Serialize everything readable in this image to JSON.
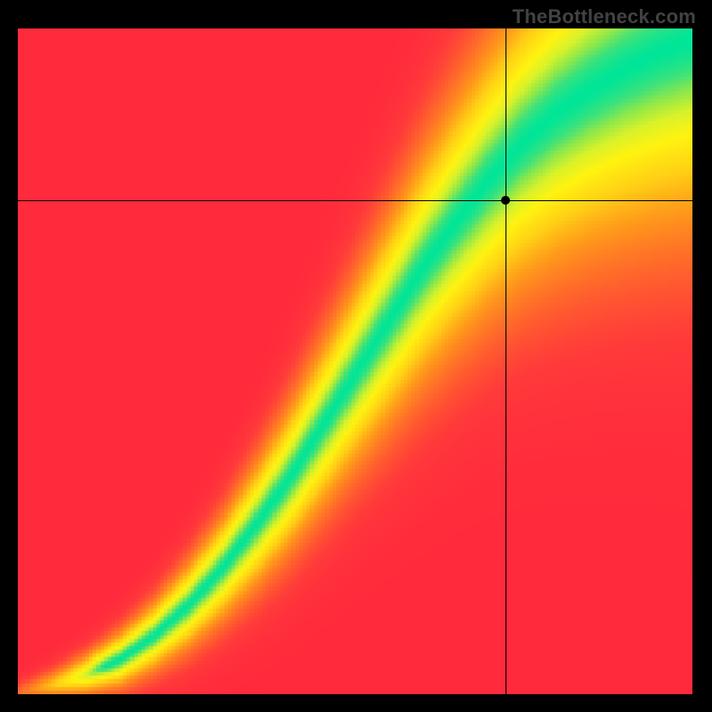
{
  "watermark": "TheBottleneck.com",
  "chart_data": {
    "type": "heatmap",
    "title": "",
    "xlabel": "",
    "ylabel": "",
    "xlim": [
      0,
      1
    ],
    "ylim": [
      0,
      1
    ],
    "crosshair": {
      "x": 0.723,
      "y": 0.742
    },
    "color_scale": [
      {
        "value": 0.0,
        "color": "#ff2a3c"
      },
      {
        "value": 0.1,
        "color": "#ff3a3a"
      },
      {
        "value": 0.25,
        "color": "#ff6a2a"
      },
      {
        "value": 0.4,
        "color": "#ff9a1a"
      },
      {
        "value": 0.55,
        "color": "#ffd015"
      },
      {
        "value": 0.7,
        "color": "#fff310"
      },
      {
        "value": 0.8,
        "color": "#d8f22a"
      },
      {
        "value": 0.88,
        "color": "#8fe84a"
      },
      {
        "value": 0.94,
        "color": "#3fe27a"
      },
      {
        "value": 1.0,
        "color": "#00e598"
      }
    ],
    "ridge_curve": {
      "description": "Fit y = f(x) along which fitness peaks (green)",
      "points": [
        [
          0.0,
          0.0
        ],
        [
          0.05,
          0.01
        ],
        [
          0.1,
          0.025
        ],
        [
          0.15,
          0.05
        ],
        [
          0.2,
          0.085
        ],
        [
          0.25,
          0.13
        ],
        [
          0.3,
          0.185
        ],
        [
          0.35,
          0.25
        ],
        [
          0.4,
          0.32
        ],
        [
          0.45,
          0.4
        ],
        [
          0.5,
          0.48
        ],
        [
          0.55,
          0.56
        ],
        [
          0.6,
          0.64
        ],
        [
          0.65,
          0.71
        ],
        [
          0.7,
          0.775
        ],
        [
          0.75,
          0.83
        ],
        [
          0.8,
          0.875
        ],
        [
          0.85,
          0.91
        ],
        [
          0.9,
          0.94
        ],
        [
          0.95,
          0.965
        ],
        [
          1.0,
          0.985
        ]
      ]
    },
    "falloff": {
      "description": "Vertical half-width of green band (fraction of axis) as function of x",
      "points": [
        [
          0.0,
          0.005
        ],
        [
          0.1,
          0.01
        ],
        [
          0.2,
          0.016
        ],
        [
          0.3,
          0.024
        ],
        [
          0.4,
          0.034
        ],
        [
          0.5,
          0.044
        ],
        [
          0.6,
          0.055
        ],
        [
          0.7,
          0.065
        ],
        [
          0.8,
          0.075
        ],
        [
          0.9,
          0.083
        ],
        [
          1.0,
          0.09
        ]
      ]
    },
    "resolution": 180
  }
}
